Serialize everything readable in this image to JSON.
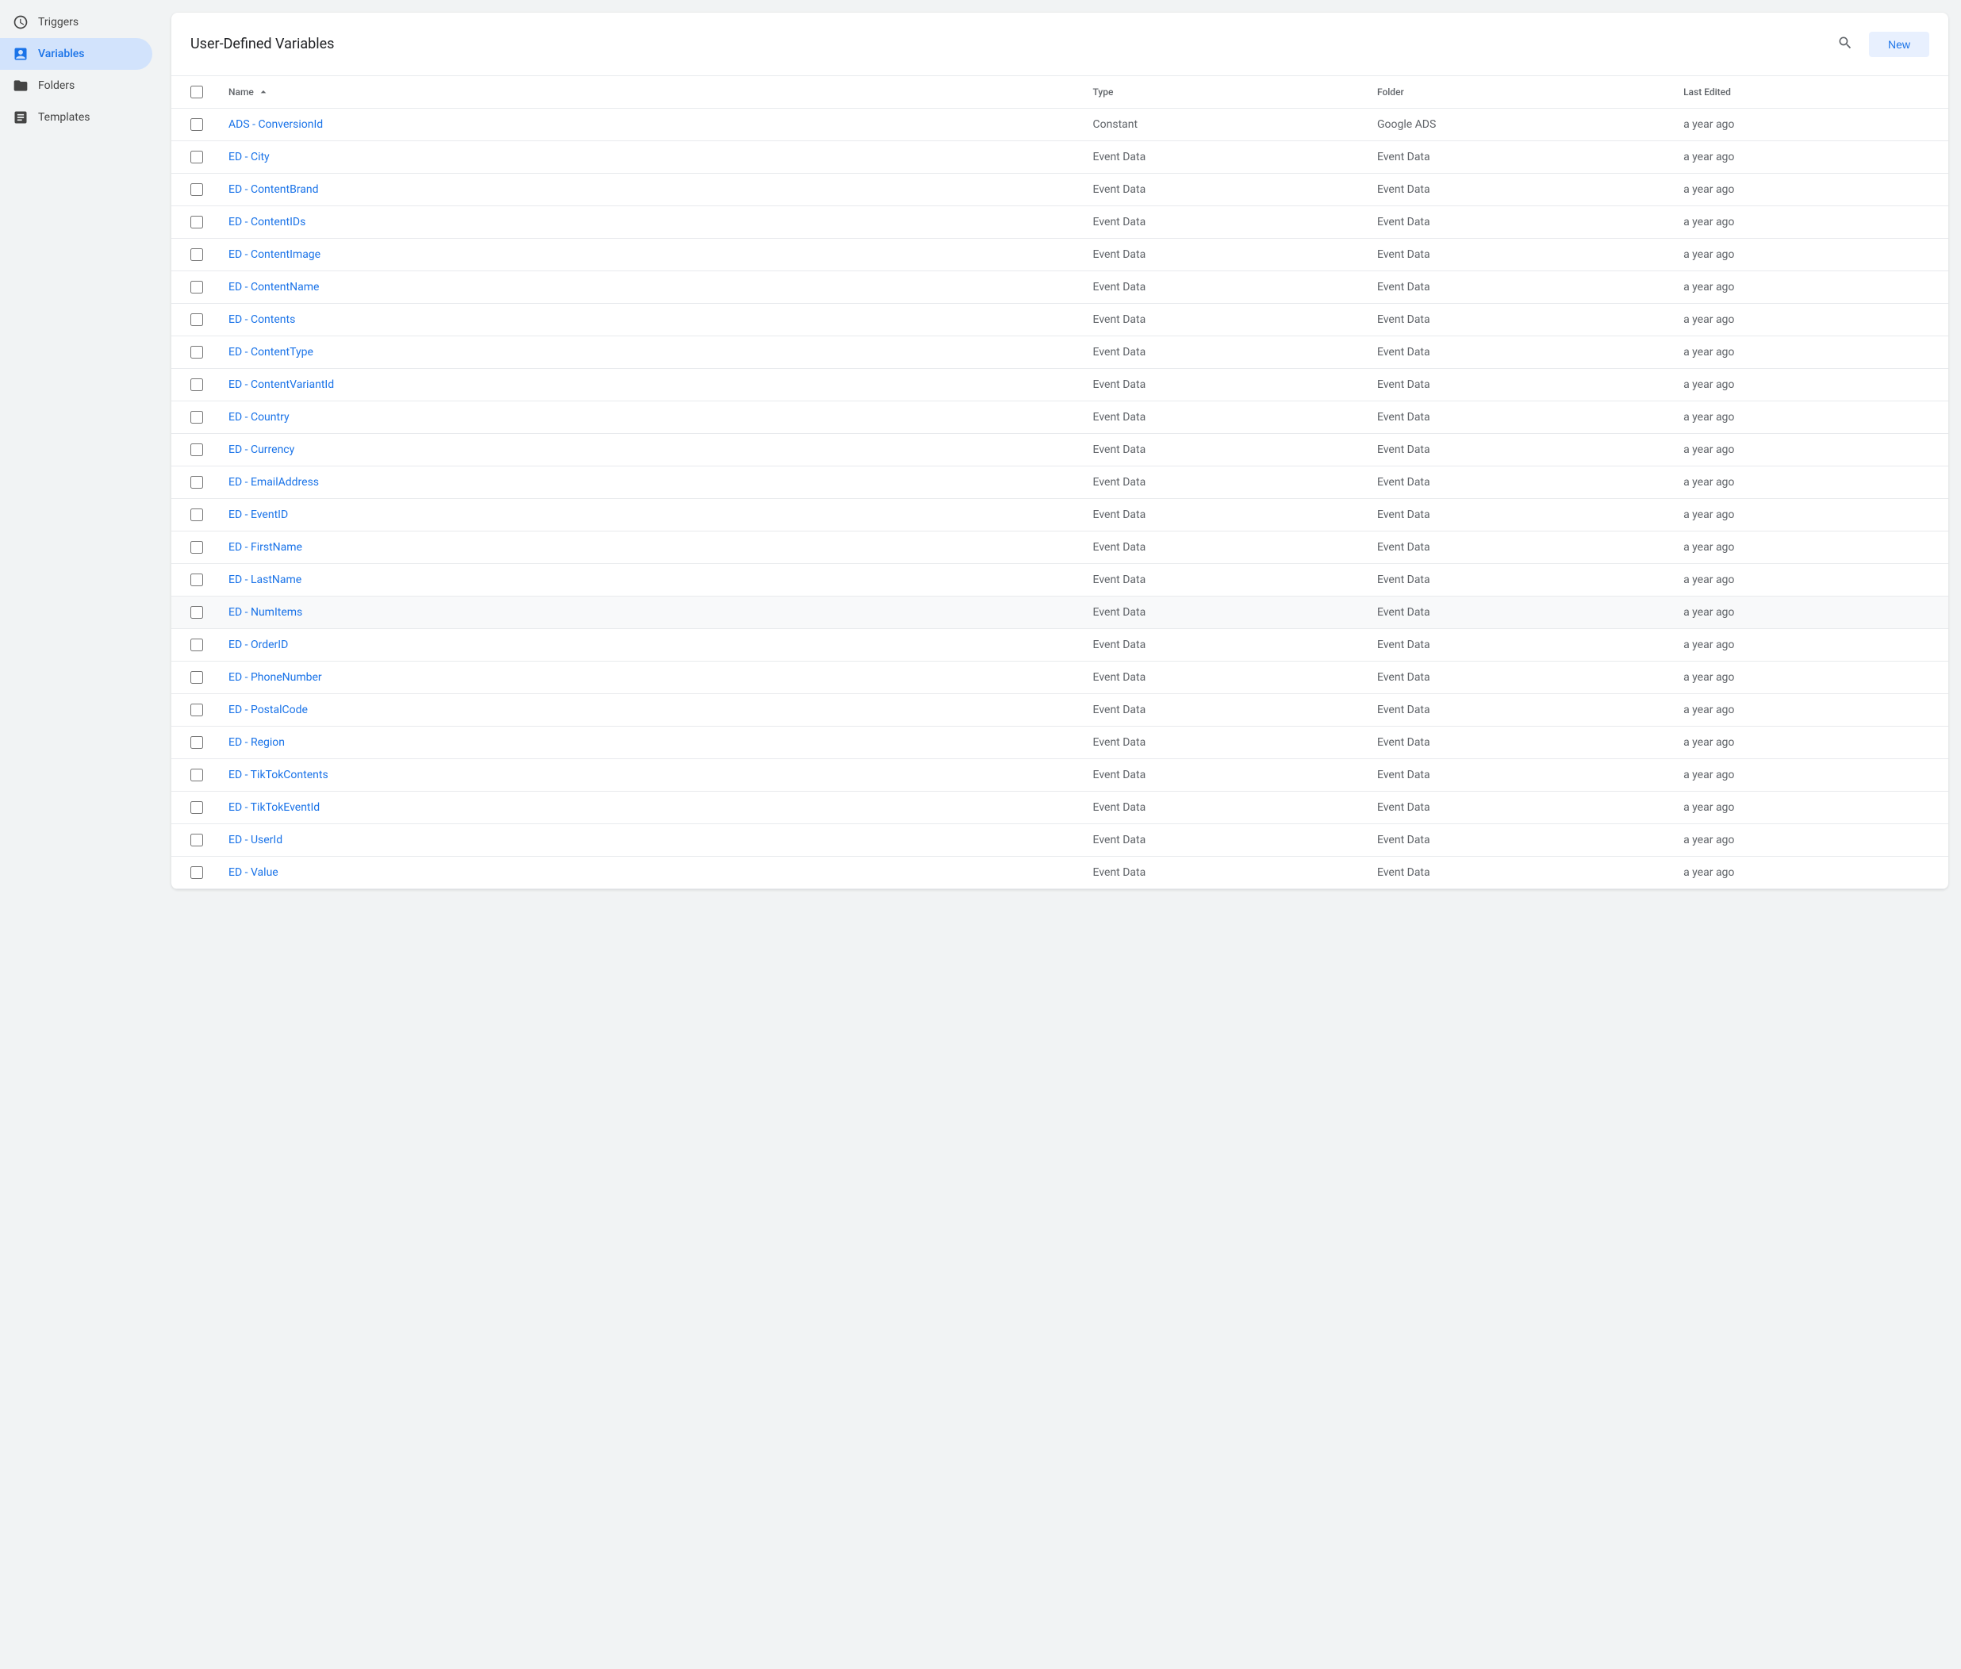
{
  "sidebar": {
    "items": [
      {
        "id": "triggers",
        "label": "Triggers",
        "icon": "clock-icon",
        "active": false
      },
      {
        "id": "variables",
        "label": "Variables",
        "icon": "variables-icon",
        "active": true
      },
      {
        "id": "folders",
        "label": "Folders",
        "icon": "folder-icon",
        "active": false
      },
      {
        "id": "templates",
        "label": "Templates",
        "icon": "template-icon",
        "active": false
      }
    ]
  },
  "header": {
    "title": "User-Defined Variables",
    "new_button_label": "New"
  },
  "table": {
    "columns": [
      {
        "id": "checkbox",
        "label": ""
      },
      {
        "id": "name",
        "label": "Name",
        "sortable": true,
        "sort_dir": "asc"
      },
      {
        "id": "type",
        "label": "Type"
      },
      {
        "id": "folder",
        "label": "Folder"
      },
      {
        "id": "last_edited",
        "label": "Last Edited"
      }
    ],
    "rows": [
      {
        "name": "ADS - ConversionId",
        "type": "Constant",
        "folder": "Google ADS",
        "last_edited": "a year ago",
        "highlighted": false
      },
      {
        "name": "ED - City",
        "type": "Event Data",
        "folder": "Event Data",
        "last_edited": "a year ago",
        "highlighted": false
      },
      {
        "name": "ED - ContentBrand",
        "type": "Event Data",
        "folder": "Event Data",
        "last_edited": "a year ago",
        "highlighted": false
      },
      {
        "name": "ED - ContentIDs",
        "type": "Event Data",
        "folder": "Event Data",
        "last_edited": "a year ago",
        "highlighted": false
      },
      {
        "name": "ED - ContentImage",
        "type": "Event Data",
        "folder": "Event Data",
        "last_edited": "a year ago",
        "highlighted": false
      },
      {
        "name": "ED - ContentName",
        "type": "Event Data",
        "folder": "Event Data",
        "last_edited": "a year ago",
        "highlighted": false
      },
      {
        "name": "ED - Contents",
        "type": "Event Data",
        "folder": "Event Data",
        "last_edited": "a year ago",
        "highlighted": false
      },
      {
        "name": "ED - ContentType",
        "type": "Event Data",
        "folder": "Event Data",
        "last_edited": "a year ago",
        "highlighted": false
      },
      {
        "name": "ED - ContentVariantId",
        "type": "Event Data",
        "folder": "Event Data",
        "last_edited": "a year ago",
        "highlighted": false
      },
      {
        "name": "ED - Country",
        "type": "Event Data",
        "folder": "Event Data",
        "last_edited": "a year ago",
        "highlighted": false
      },
      {
        "name": "ED - Currency",
        "type": "Event Data",
        "folder": "Event Data",
        "last_edited": "a year ago",
        "highlighted": false
      },
      {
        "name": "ED - EmailAddress",
        "type": "Event Data",
        "folder": "Event Data",
        "last_edited": "a year ago",
        "highlighted": false
      },
      {
        "name": "ED - EventID",
        "type": "Event Data",
        "folder": "Event Data",
        "last_edited": "a year ago",
        "highlighted": false
      },
      {
        "name": "ED - FirstName",
        "type": "Event Data",
        "folder": "Event Data",
        "last_edited": "a year ago",
        "highlighted": false
      },
      {
        "name": "ED - LastName",
        "type": "Event Data",
        "folder": "Event Data",
        "last_edited": "a year ago",
        "highlighted": false
      },
      {
        "name": "ED - NumItems",
        "type": "Event Data",
        "folder": "Event Data",
        "last_edited": "a year ago",
        "highlighted": true
      },
      {
        "name": "ED - OrderID",
        "type": "Event Data",
        "folder": "Event Data",
        "last_edited": "a year ago",
        "highlighted": false
      },
      {
        "name": "ED - PhoneNumber",
        "type": "Event Data",
        "folder": "Event Data",
        "last_edited": "a year ago",
        "highlighted": false
      },
      {
        "name": "ED - PostalCode",
        "type": "Event Data",
        "folder": "Event Data",
        "last_edited": "a year ago",
        "highlighted": false
      },
      {
        "name": "ED - Region",
        "type": "Event Data",
        "folder": "Event Data",
        "last_edited": "a year ago",
        "highlighted": false
      },
      {
        "name": "ED - TikTokContents",
        "type": "Event Data",
        "folder": "Event Data",
        "last_edited": "a year ago",
        "highlighted": false
      },
      {
        "name": "ED - TikTokEventId",
        "type": "Event Data",
        "folder": "Event Data",
        "last_edited": "a year ago",
        "highlighted": false
      },
      {
        "name": "ED - UserId",
        "type": "Event Data",
        "folder": "Event Data",
        "last_edited": "a year ago",
        "highlighted": false
      },
      {
        "name": "ED - Value",
        "type": "Event Data",
        "folder": "Event Data",
        "last_edited": "a year ago",
        "highlighted": false
      }
    ]
  }
}
